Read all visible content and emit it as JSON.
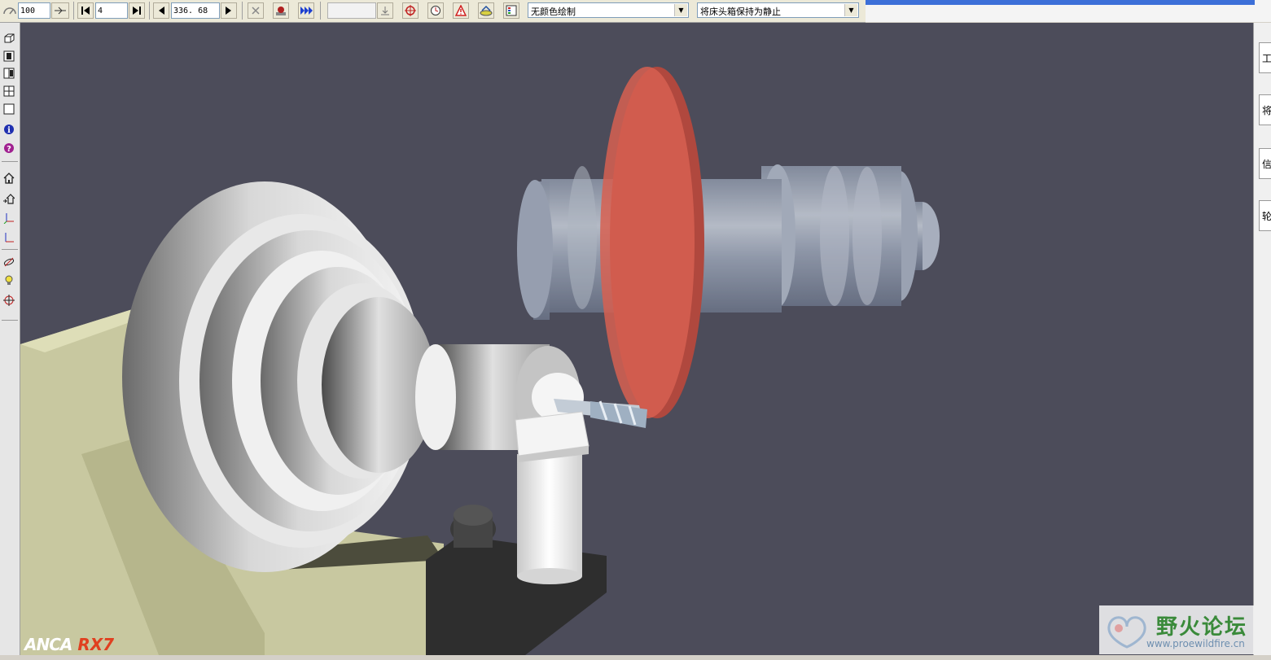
{
  "toolbar": {
    "speed_value": "100",
    "step_value": "4",
    "position_value": "336. 68",
    "empty_field_value": "",
    "color_mode_select": "无颜色绘制",
    "headstock_select": "将床头箱保持为静止"
  },
  "viewport": {
    "background_color": "#4c4c5a",
    "logo_text_1": "ANCA",
    "logo_text_2": "RX7"
  },
  "right_tabs": [
    "工",
    "将",
    "信",
    "轮"
  ],
  "watermark": {
    "text": "野火论坛",
    "url": "www.proewildfire.cn"
  }
}
